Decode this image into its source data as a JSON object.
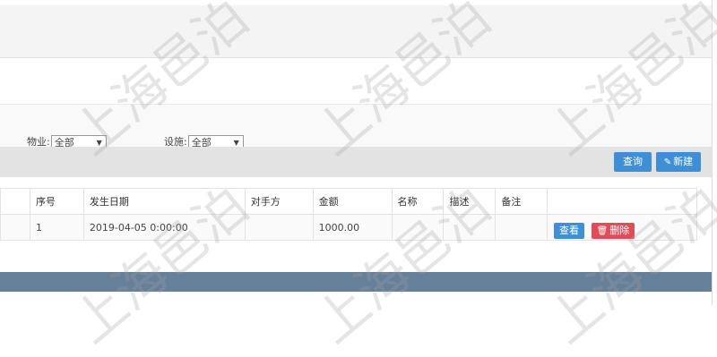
{
  "filters": [
    {
      "label": "物业:",
      "value": "全部"
    },
    {
      "label": "设施:",
      "value": "全部"
    }
  ],
  "toolbar": {
    "query_label": "查询",
    "new_label": "新建"
  },
  "table": {
    "headers": [
      "序号",
      "发生日期",
      "对手方",
      "金额",
      "名称",
      "描述",
      "备注",
      ""
    ],
    "rows": [
      {
        "index": "1",
        "date": "2019-04-05 0:00:00",
        "counterparty": "",
        "amount": "1000.00",
        "name": "",
        "desc": "",
        "note": "",
        "view_label": "查看",
        "delete_label": "删除"
      }
    ]
  },
  "watermark": "上海邑泊"
}
